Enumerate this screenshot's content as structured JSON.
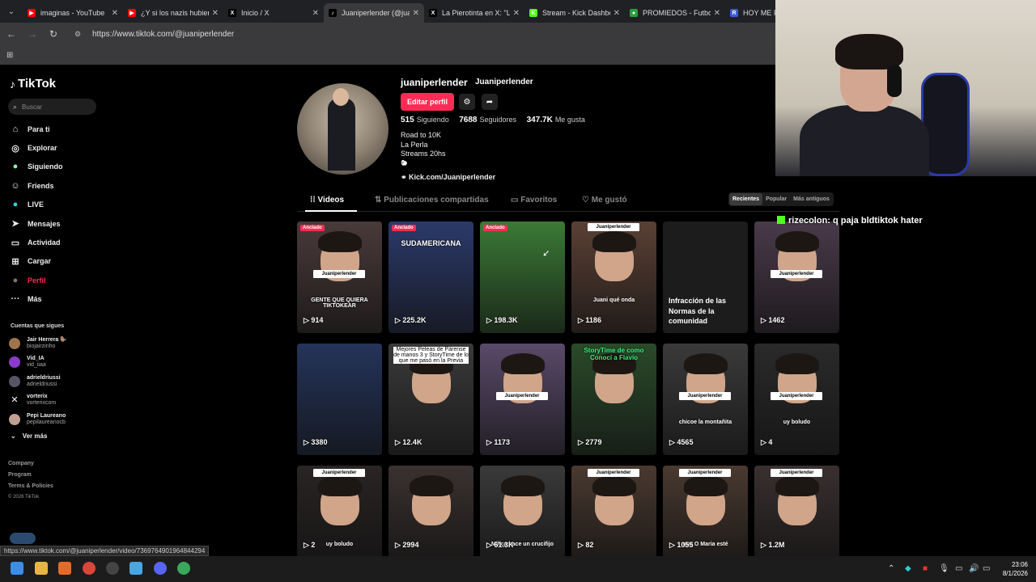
{
  "browser": {
    "tabs": [
      {
        "title": "imaginas - YouTube",
        "color": "#ff0000",
        "glyph": "▶",
        "close": "✕"
      },
      {
        "title": "¿Y si los nazis hubieran",
        "color": "#ff0000",
        "glyph": "▶",
        "close": "✕"
      },
      {
        "title": "Inicio / X",
        "color": "#000000",
        "glyph": "X",
        "close": "✕"
      },
      {
        "title": "Juaniperlender (@jua",
        "color": "#000000",
        "glyph": "♪",
        "close": "✕"
      },
      {
        "title": "La Pierotinta en X: \"L",
        "color": "#000000",
        "glyph": "X",
        "close": "✕"
      },
      {
        "title": "Stream - Kick Dashbo",
        "color": "#53fc18",
        "glyph": "K",
        "close": "✕"
      },
      {
        "title": "PROMIEDOS - Futbol",
        "color": "#2e9c3b",
        "glyph": "●",
        "close": "✕"
      },
      {
        "title": "HOY ME PASO",
        "color": "#3b5bdb",
        "glyph": "R",
        "close": ""
      }
    ],
    "url": "https://www.tiktok.com/@juaniperlender",
    "status_url": "https://www.tiktok.com/@juaniperlender/video/7369764901964844294"
  },
  "sidebar": {
    "brand": "TikTok",
    "search_placeholder": "Buscar",
    "nav": [
      {
        "label": "Para ti",
        "icon": "⌂",
        "name": "home"
      },
      {
        "label": "Explorar",
        "icon": "◎",
        "name": "explore"
      },
      {
        "label": "Siguiendo",
        "icon": "●",
        "name": "following"
      },
      {
        "label": "Friends",
        "icon": "☺",
        "name": "friends"
      },
      {
        "label": "LIVE",
        "icon": "●",
        "name": "live"
      },
      {
        "label": "Mensajes",
        "icon": "➤",
        "name": "messages"
      },
      {
        "label": "Actividad",
        "icon": "▭",
        "name": "activity"
      },
      {
        "label": "Cargar",
        "icon": "⊞",
        "name": "upload"
      },
      {
        "label": "Perfil",
        "icon": "●",
        "name": "profile"
      },
      {
        "label": "Más",
        "icon": "···",
        "name": "more"
      }
    ],
    "following_title": "Cuentas que sigues",
    "accounts": [
      {
        "name": "Jair Herrera 🦫",
        "handle": "biojairzinho",
        "color": "#a0744a"
      },
      {
        "name": "Vid_IA",
        "handle": "vid_iiaa",
        "color": "#8a3cc8"
      },
      {
        "name": "adrieldriussi",
        "handle": "adrieldriussi",
        "color": "#555566"
      },
      {
        "name": "vorterix",
        "handle": "vorterixcom",
        "color": "#000000"
      },
      {
        "name": "Pepi Laureano",
        "handle": "pepilaureanocb",
        "color": "#c0a090"
      }
    ],
    "see_more": "Ver más",
    "footer": [
      "Company",
      "Program",
      "Terms & Policies"
    ],
    "copyright": "© 2026 TikTok"
  },
  "profile": {
    "username": "juaniperlender",
    "display_name": "Juaniperlender",
    "edit_label": "Editar perfil",
    "following_count": "515",
    "following_label": "Siguiendo",
    "followers_count": "7688",
    "followers_label": "Seguidores",
    "likes_count": "347.7K",
    "likes_label": "Me gusta",
    "bio": [
      "Road to 10K",
      "La Perla",
      "Streams 20hs",
      "🐑"
    ],
    "link": "Kick.com/Juaniperlender"
  },
  "tabs": {
    "videos": "Videos",
    "reposts": "Publicaciones compartidas",
    "favorites": "Favoritos",
    "liked": "Me gustó",
    "sort": [
      "Recientes",
      "Popular",
      "Más antiguos"
    ]
  },
  "videos": [
    {
      "views": "914",
      "pinned": "Anclado",
      "bg": "#4a3a3a",
      "caption": "GENTE QUE QUIERA TIKTOKEAR",
      "wm": "Juaniperlender"
    },
    {
      "views": "225.2K",
      "pinned": "Anclado",
      "bg": "#2b3a6a",
      "caption": "SUDAMERICANA",
      "wm": ""
    },
    {
      "views": "198.3K",
      "pinned": "Anclado",
      "bg": "#3b7a35",
      "caption": "",
      "wm": ""
    },
    {
      "views": "1186",
      "pinned": "",
      "bg": "#5a4035",
      "caption": "Juani qué onda",
      "wm": "Juaniperlender"
    },
    {
      "views": "",
      "pinned": "",
      "bg": "#1c1c1c",
      "caption": "Infracción de las Normas de la comunidad",
      "wm": ""
    },
    {
      "views": "1462",
      "pinned": "",
      "bg": "#4a3a4a",
      "caption": "",
      "wm": "Juaniperlender"
    },
    {
      "views": "3380",
      "pinned": "",
      "bg": "#24345a",
      "caption": "",
      "wm": ""
    },
    {
      "views": "12.4K",
      "pinned": "",
      "bg": "#3a3a3a",
      "caption": "Mejores Peleas de Párense de manos 3 y StoryTime de lo que me pasó en la Previa",
      "wm": ""
    },
    {
      "views": "1173",
      "pinned": "",
      "bg": "#5a4a6a",
      "caption": "",
      "wm": "Juaniperlender"
    },
    {
      "views": "2779",
      "pinned": "",
      "bg": "#2a4a2a",
      "caption": "StoryTime de como Conocí a Flavio",
      "wm": ""
    },
    {
      "views": "4565",
      "pinned": "",
      "bg": "#3a3a3a",
      "caption": "chicoe la montañita",
      "wm": "Juaniperlender"
    },
    {
      "views": "4",
      "pinned": "",
      "bg": "#2a2a2a",
      "caption": "uy boludo",
      "wm": "Juaniperlender"
    },
    {
      "views": "2",
      "pinned": "",
      "bg": "#2a2424",
      "caption": "uy boludo",
      "wm": "Juaniperlender"
    },
    {
      "views": "2994",
      "pinned": "",
      "bg": "#3a3230",
      "caption": "",
      "wm": ""
    },
    {
      "views": "61.3K",
      "pinned": "",
      "bg": "#3a3a3a",
      "caption": "Milica hace un crucifijo",
      "wm": ""
    },
    {
      "views": "82",
      "pinned": "",
      "bg": "#4a3a30",
      "caption": "",
      "wm": "Juaniperlender"
    },
    {
      "views": "1055",
      "pinned": "",
      "bg": "#4a3a30",
      "caption": "que O Maria esté",
      "wm": "Juaniperlender"
    },
    {
      "views": "1.2M",
      "pinned": "",
      "bg": "#3a3030",
      "caption": "",
      "wm": "Juaniperlender"
    }
  ],
  "chat": {
    "user": "rizecolon",
    "message": ": q paja bldtiktok hater",
    "accent": "#53fc18"
  },
  "taskbar": {
    "time": "23:06",
    "date": "8/1/2026"
  }
}
